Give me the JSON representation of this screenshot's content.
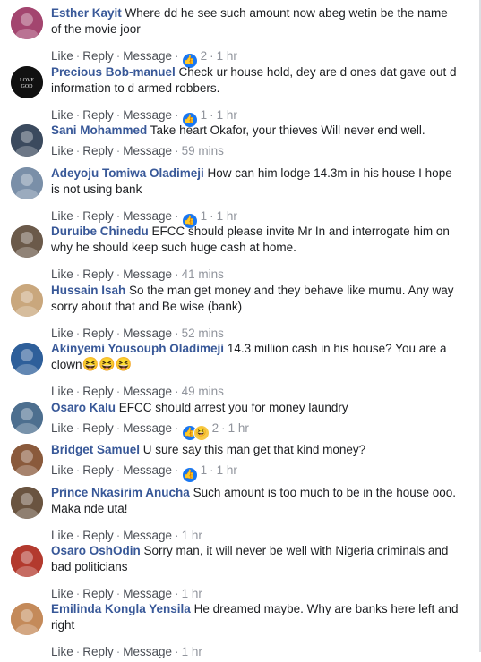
{
  "actions": {
    "like": "Like",
    "reply": "Reply",
    "message": "Message",
    "sep": "·"
  },
  "comments": [
    {
      "author": "Esther Kayit",
      "text": "Where dd he see such amount now abeg wetin be the name of the movie joor",
      "reactions": "2",
      "time": "1 hr",
      "avatar_color": "#a3456f"
    },
    {
      "author": "Precious Bob-manuel",
      "text": "Check ur house hold, dey are d ones dat gave out d information to d armed robbers.",
      "reactions": "1",
      "time": "1 hr",
      "avatar_color": "#1e1e1e",
      "avatar_text": "LOVE GOD"
    },
    {
      "author": "Sani Mohammed",
      "text": "Take heart Okafor, your thieves Will never end well.",
      "time": "59 mins",
      "avatar_color": "#3b4a5e"
    },
    {
      "author": "Adeyoju Tomiwa Oladimeji",
      "text": "How can him lodge 14.3m in his house I hope is not using bank",
      "reactions": "1",
      "time": "1 hr",
      "avatar_color": "#7a8fa8"
    },
    {
      "author": "Duruibe Chinedu",
      "text": "EFCC should please invite Mr In and interrogate him on why he should keep such huge cash at home.",
      "time": "41 mins",
      "avatar_color": "#6b5a4a"
    },
    {
      "author": "Hussain Isah",
      "text": "So the man get money and they behave like mumu. Any way sorry about that and Be wise (bank)",
      "time": "52 mins",
      "avatar_color": "#c9a77d"
    },
    {
      "author": "Akinyemi Yousouph Oladimeji",
      "text": "14.3 million cash in his house? You are a clown",
      "emoji": "😆😆😆",
      "time": "49 mins",
      "avatar_color": "#2e5f9a"
    },
    {
      "author": "Osaro Kalu",
      "text": "EFCC should arrest you for money laundry",
      "reactions": "2",
      "reaction_haha": true,
      "time": "1 hr",
      "avatar_color": "#4d6f8f"
    },
    {
      "author": "Bridget Samuel",
      "text": "U sure say this man get that kind money?",
      "reactions": "1",
      "time": "1 hr",
      "avatar_color": "#8a5a3c"
    },
    {
      "author": "Prince Nkasirim Anucha",
      "text": "Such amount is too much to be in the house ooo. Maka nde uta!",
      "time": "1 hr",
      "avatar_color": "#6a5440"
    },
    {
      "author": "Osaro OshOdin",
      "text": "Sorry man, it will never be well with Nigeria criminals and bad politicians",
      "time": "1 hr",
      "avatar_color": "#b33a2e"
    },
    {
      "author": "Emilinda Kongla Yensila",
      "text": "He dreamed maybe. Why are banks here left and right",
      "time": "1 hr",
      "avatar_color": "#c48a5a"
    }
  ]
}
